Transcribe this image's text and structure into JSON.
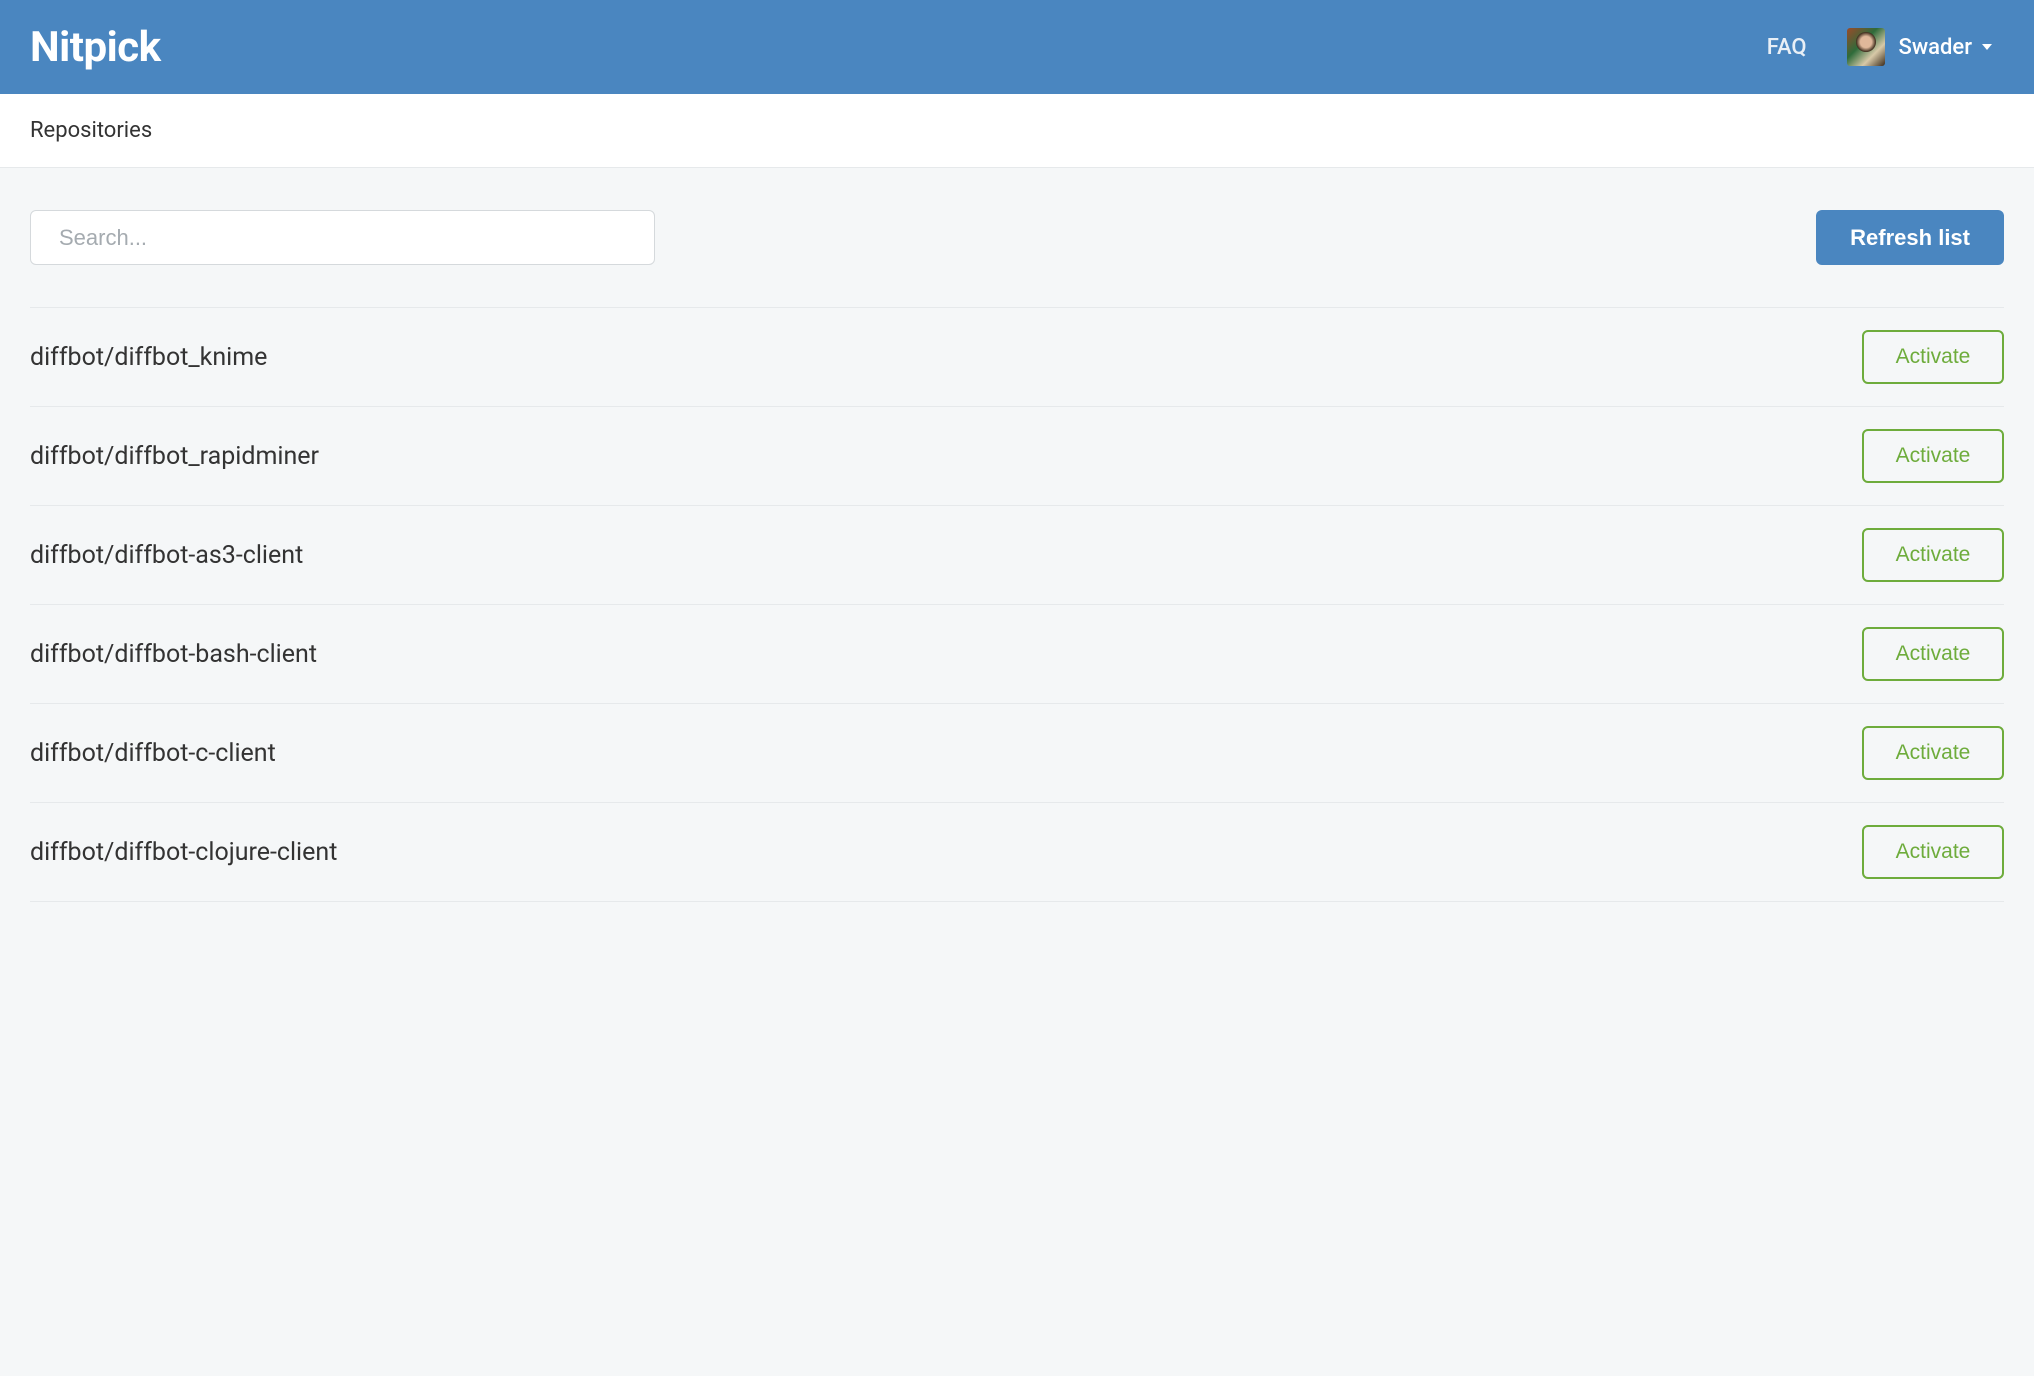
{
  "header": {
    "logo": "Nitpick",
    "faq": "FAQ",
    "username": "Swader"
  },
  "subheader": {
    "title": "Repositories"
  },
  "toolbar": {
    "search_placeholder": "Search...",
    "refresh_label": "Refresh list"
  },
  "repos": [
    {
      "name": "diffbot/diffbot_knime",
      "action": "Activate"
    },
    {
      "name": "diffbot/diffbot_rapidminer",
      "action": "Activate"
    },
    {
      "name": "diffbot/diffbot-as3-client",
      "action": "Activate"
    },
    {
      "name": "diffbot/diffbot-bash-client",
      "action": "Activate"
    },
    {
      "name": "diffbot/diffbot-c-client",
      "action": "Activate"
    },
    {
      "name": "diffbot/diffbot-clojure-client",
      "action": "Activate"
    }
  ],
  "colors": {
    "primary": "#4a86c0",
    "success": "#6eac3c",
    "background": "#f5f7f8"
  }
}
